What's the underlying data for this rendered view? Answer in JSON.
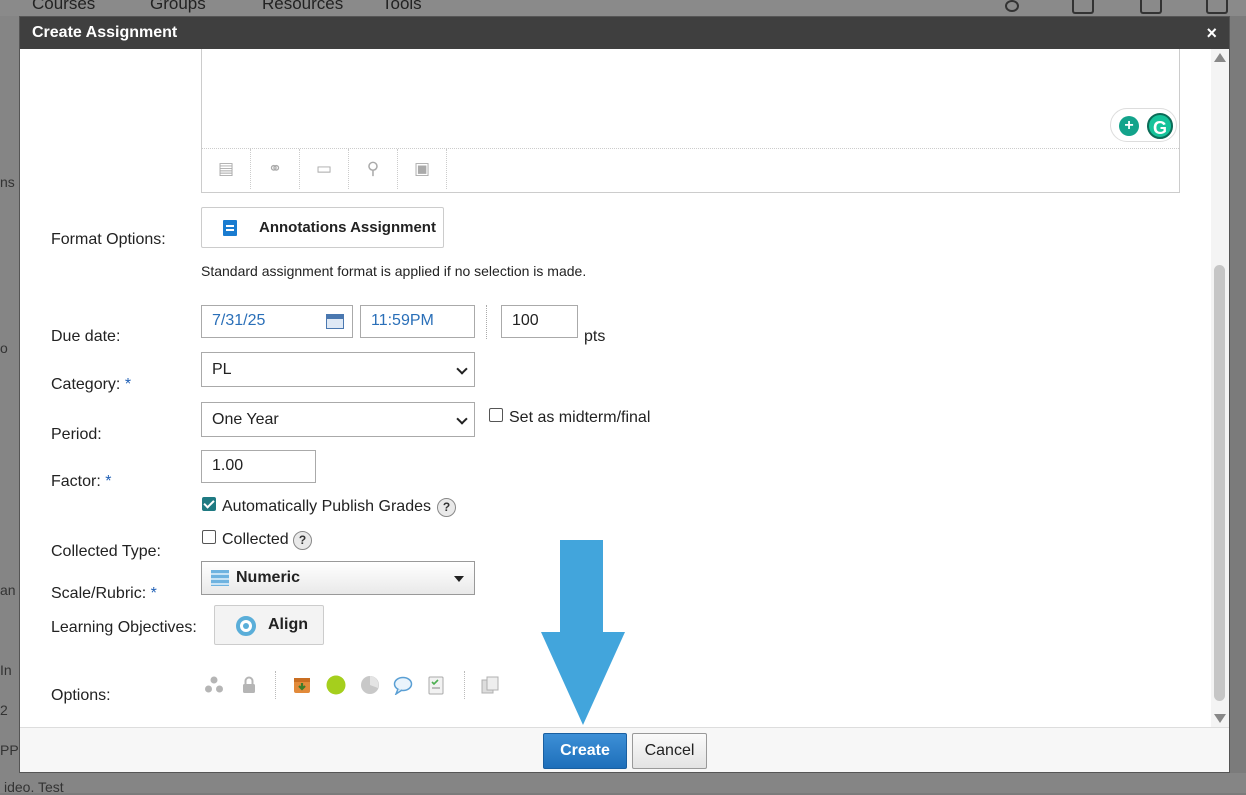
{
  "background": {
    "nav": [
      "Courses",
      "Groups",
      "Resources",
      "Tools"
    ],
    "left_fragments": [
      "ns",
      "o",
      "an",
      "In",
      "2",
      "PP"
    ],
    "bottom_fragment": "ideo. Test"
  },
  "modal": {
    "title": "Create Assignment",
    "close_label": "×"
  },
  "form": {
    "format_options": {
      "label": "Format Options:",
      "button_label": "Annotations Assignment",
      "hint": "Standard assignment format is applied if no selection is made."
    },
    "due_date": {
      "label": "Due date:",
      "date": "7/31/25",
      "time": "11:59PM",
      "points": "100",
      "points_unit": "pts"
    },
    "category": {
      "label": "Category:",
      "required_mark": "*",
      "value": "PL"
    },
    "period": {
      "label": "Period:",
      "value": "One Year",
      "midterm_label": "Set as midterm/final",
      "midterm_checked": false
    },
    "factor": {
      "label": "Factor:",
      "required_mark": "*",
      "value": "1.00"
    },
    "auto_publish": {
      "label": "Automatically Publish Grades",
      "checked": true,
      "help": "?"
    },
    "collected_type": {
      "label": "Collected Type:",
      "checkbox_label": "Collected",
      "checked": false,
      "help": "?"
    },
    "scale_rubric": {
      "label": "Scale/Rubric:",
      "required_mark": "*",
      "value": "Numeric"
    },
    "learning_objectives": {
      "label": "Learning Objectives:",
      "button_label": "Align"
    },
    "options": {
      "label": "Options:",
      "icons": [
        "individual-assign-icon",
        "lock-icon",
        "download-submissions-icon",
        "green-dot-icon",
        "grade-stats-icon",
        "comments-icon",
        "checklist-icon",
        "copy-icon"
      ]
    }
  },
  "footer": {
    "create_label": "Create",
    "cancel_label": "Cancel"
  },
  "colors": {
    "accent": "#1e6fba",
    "arrow": "#42a5dc",
    "title_bar": "#3f3f3f",
    "checkbox_on": "#1f7a82",
    "green_option": "#a5cf1d"
  }
}
